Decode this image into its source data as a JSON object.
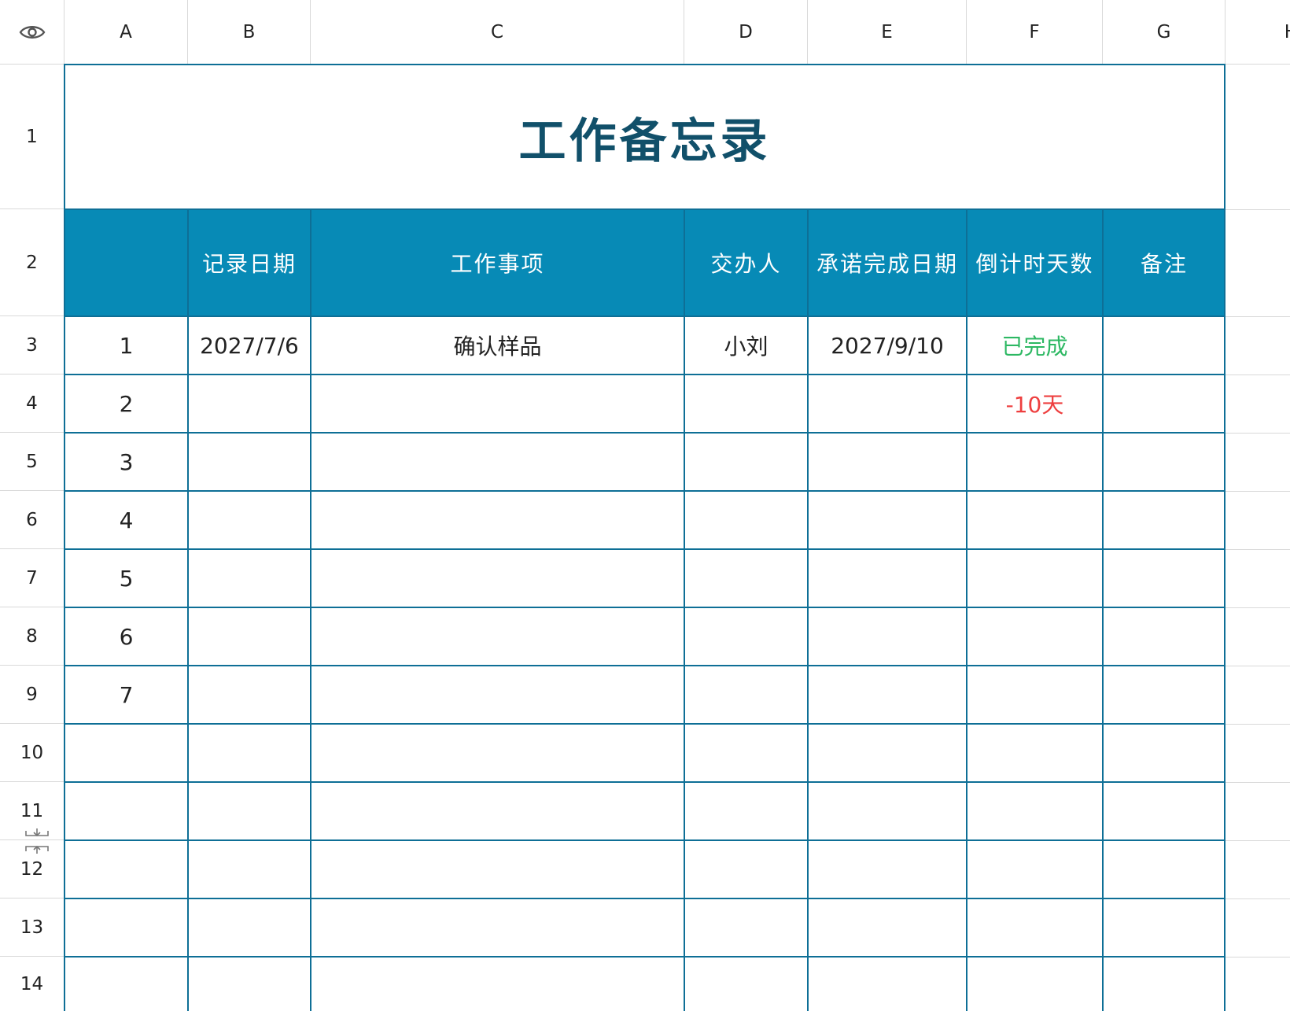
{
  "sheet": {
    "columns": [
      "A",
      "B",
      "C",
      "D",
      "E",
      "F",
      "G",
      "H"
    ],
    "row_numbers": [
      "1",
      "2",
      "3",
      "4",
      "5",
      "6",
      "7",
      "8",
      "9",
      "10",
      "11",
      "12",
      "13",
      "14"
    ],
    "title": "工作备忘录",
    "headers": [
      "",
      "记录日期",
      "工作事项",
      "交办人",
      "承诺完成日期",
      "倒计时天数",
      "备注"
    ],
    "rows": [
      {
        "no": "1",
        "date": "2027/7/6",
        "task": "确认样品",
        "assignee": "小刘",
        "due": "2027/9/10",
        "countdown": "已完成",
        "note": ""
      },
      {
        "no": "2",
        "date": "",
        "task": "",
        "assignee": "",
        "due": "",
        "countdown": "-10天",
        "note": ""
      },
      {
        "no": "3",
        "date": "",
        "task": "",
        "assignee": "",
        "due": "",
        "countdown": "",
        "note": ""
      },
      {
        "no": "4",
        "date": "",
        "task": "",
        "assignee": "",
        "due": "",
        "countdown": "",
        "note": ""
      },
      {
        "no": "5",
        "date": "",
        "task": "",
        "assignee": "",
        "due": "",
        "countdown": "",
        "note": ""
      },
      {
        "no": "6",
        "date": "",
        "task": "",
        "assignee": "",
        "due": "",
        "countdown": "",
        "note": ""
      },
      {
        "no": "7",
        "date": "",
        "task": "",
        "assignee": "",
        "due": "",
        "countdown": "",
        "note": ""
      }
    ],
    "colors": {
      "header_bg": "#078ab6",
      "border": "#0e6f96",
      "title": "#11506a",
      "done": "#2db863",
      "overdue": "#ee3f3f"
    },
    "icons": {
      "corner": "eye-icon",
      "row_resize": "row-resize-icon"
    }
  }
}
